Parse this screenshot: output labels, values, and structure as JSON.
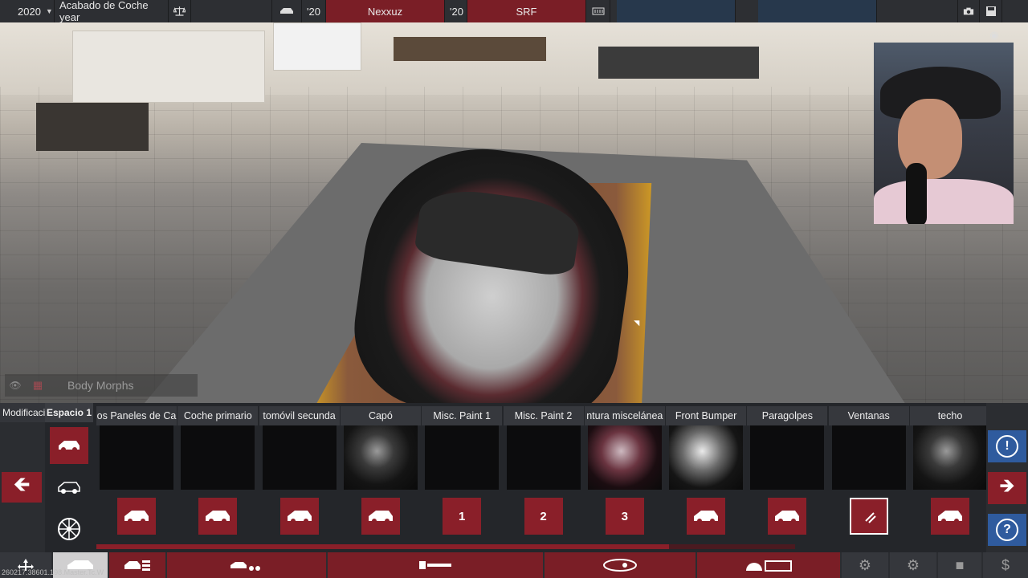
{
  "topbar": {
    "year": "2020",
    "project_title": "Acabado de Coche year",
    "car_year": "'20",
    "model_name": "Nexxuz",
    "trim_year": "'20",
    "trim_name": "SRF"
  },
  "body_morphs": {
    "label": "Body Morphs"
  },
  "tabs": {
    "mods": "Modificaciones",
    "space": "Espacio 1"
  },
  "items": [
    {
      "label": "Todos Paneles de Carrocería",
      "display": "os Paneles de Ca",
      "button": "car",
      "thumb": "dark"
    },
    {
      "label": "Coche primario",
      "display": "Coche primario",
      "button": "car",
      "thumb": "dark"
    },
    {
      "label": "Automóvil secundario",
      "display": "tomóvil secunda",
      "button": "car",
      "thumb": "dark"
    },
    {
      "label": "Capó",
      "display": "Capó",
      "button": "car",
      "thumb": "sphere"
    },
    {
      "label": "Misc. Paint 1",
      "display": "Misc. Paint 1",
      "button": "1",
      "thumb": "dark"
    },
    {
      "label": "Misc. Paint 2",
      "display": "Misc. Paint 2",
      "button": "2",
      "thumb": "dark"
    },
    {
      "label": "Pintura miscelánea",
      "display": "ntura miscelánea",
      "button": "3",
      "thumb": "sparkle"
    },
    {
      "label": "Front Bumper",
      "display": "Front Bumper",
      "button": "car",
      "thumb": "sparkle2"
    },
    {
      "label": "Paragolpes",
      "display": "Paragolpes",
      "button": "car",
      "thumb": "dark"
    },
    {
      "label": "Ventanas",
      "display": "Ventanas",
      "button": "glass",
      "thumb": "dark"
    },
    {
      "label": "techo",
      "display": "techo",
      "button": "car",
      "thumb": "sphere"
    }
  ],
  "progress": 0.82,
  "version_text": "260217.38601.198.Master.Tc.W",
  "colors": {
    "accent": "#8a1f29",
    "help_blue": "#2f5b9e",
    "bar_dark": "#2d2f33"
  },
  "icons": [
    "balance-icon",
    "car-icon",
    "grid-icon",
    "camera-icon",
    "save-icon",
    "arrow-left-icon",
    "arrow-right-icon",
    "help-icon",
    "info-icon",
    "wheel-icon"
  ]
}
